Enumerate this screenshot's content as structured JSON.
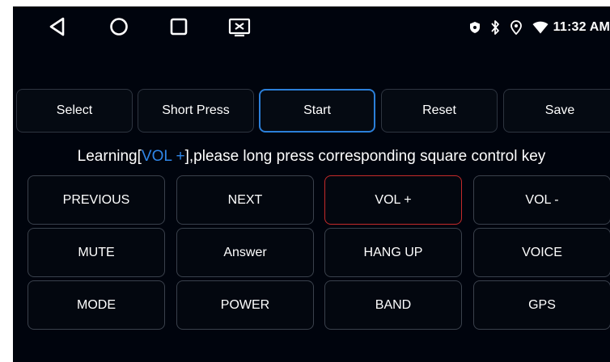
{
  "status_bar": {
    "nav_icons": [
      "back-icon",
      "home-icon",
      "recents-icon",
      "screen-icon"
    ],
    "status_icons": [
      "shield-icon",
      "bluetooth-icon",
      "location-icon",
      "wifi-icon"
    ],
    "time": "11:32 AM"
  },
  "toolbar": {
    "buttons": [
      "Select",
      "Short Press",
      "Start",
      "Reset",
      "Save"
    ],
    "active": "Start"
  },
  "message": {
    "prefix": "Learning[",
    "key": "VOL +",
    "suffix": "],please long press corresponding square control key"
  },
  "keys": {
    "rows": [
      [
        "PREVIOUS",
        "NEXT",
        "VOL +",
        "VOL -"
      ],
      [
        "MUTE",
        "Answer",
        "HANG UP",
        "VOICE"
      ],
      [
        "MODE",
        "POWER",
        "BAND",
        "GPS"
      ]
    ],
    "selected": "VOL +"
  },
  "colors": {
    "background": "#00040d",
    "accent_blue": "#2b7fd9",
    "highlight_text": "#2f86e8",
    "selected_border": "#c42a2a"
  }
}
